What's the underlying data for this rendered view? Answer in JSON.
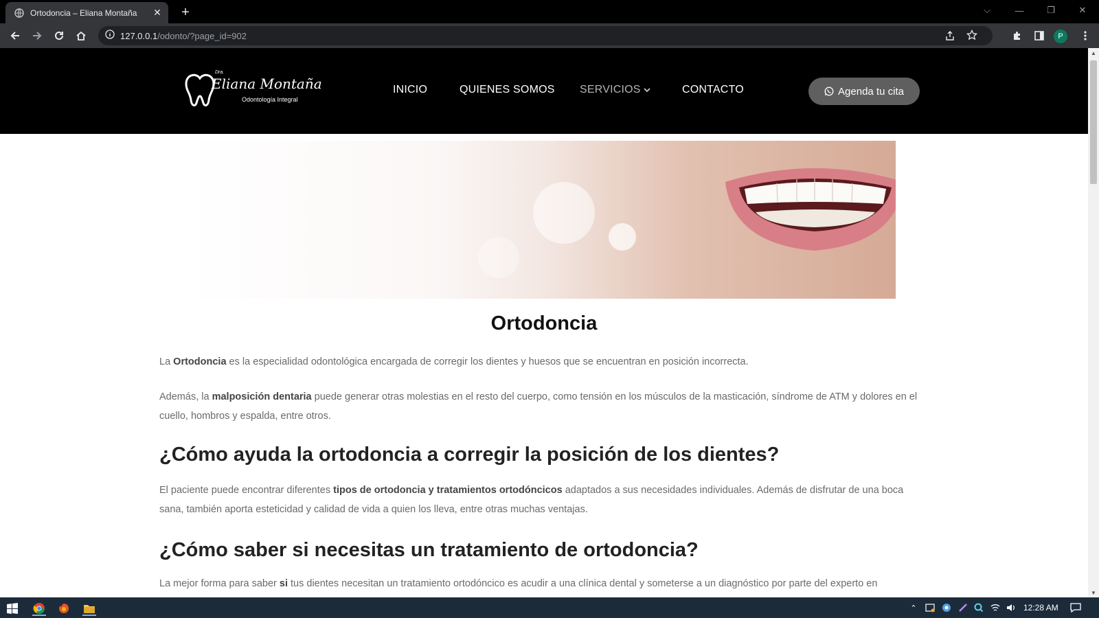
{
  "browser": {
    "tab_title": "Ortodoncia – Eliana Montaña",
    "url_host": "127.0.0.1",
    "url_path": "/odonto/?page_id=902",
    "profile_initial": "P"
  },
  "site": {
    "logo": {
      "prefix": "Dra.",
      "name": "Eliana Montaña",
      "tagline": "Odontología Integral"
    },
    "nav": {
      "items": [
        "INICIO",
        "QUIENES SOMOS",
        "SERVICIOS",
        "CONTACTO"
      ],
      "cta_label": "Agenda tu cita"
    }
  },
  "content": {
    "title": "Ortodoncia",
    "p1": {
      "a": "La ",
      "b": "Ortodoncia",
      "c": " es la especialidad odontológica encargada de corregir los dientes y huesos que se encuentran en posición incorrecta."
    },
    "p2": {
      "a": "Además, la ",
      "b": "malposición dentaria",
      "c": " puede generar otras molestias en el resto del cuerpo, como tensión en los músculos de la masticación, síndrome de ATM y dolores en el cuello, hombros y espalda, entre otros."
    },
    "h2_1": "¿Cómo ayuda la ortodoncia a corregir la posición de los dientes?",
    "p3": {
      "a": "El paciente puede encontrar diferentes ",
      "b": "tipos de ortodoncia y tratamientos ortodóncicos",
      "c": " adaptados a sus necesidades individuales. Además de disfrutar de una boca sana, también aporta esteticidad y calidad de vida a quien los lleva, entre otras muchas ventajas."
    },
    "h2_2": "¿Cómo saber si necesitas un tratamiento de ortodoncia?",
    "p4": {
      "a": "La mejor forma para saber ",
      "b": "si",
      "c": " tus dientes necesitan un tratamiento ortodóncico es acudir a una clínica dental y someterse a un diagnóstico por parte del experto en"
    }
  },
  "taskbar": {
    "time": "12:28 AM"
  },
  "colors": {
    "header_bg": "#000000",
    "cta_bg": "#5f5f5f",
    "nav_active": "#b5b5b5",
    "taskbar_bg": "#1c2b3a"
  }
}
